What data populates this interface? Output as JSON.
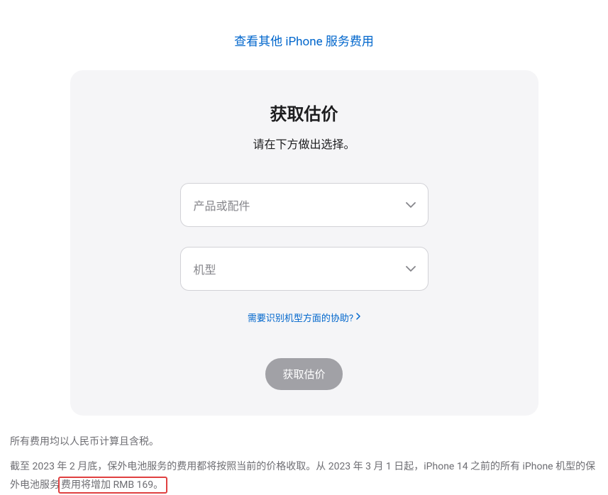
{
  "top_link": "查看其他 iPhone 服务费用",
  "card": {
    "title": "获取估价",
    "subtitle": "请在下方做出选择。",
    "select_product_placeholder": "产品或配件",
    "select_model_placeholder": "机型",
    "help_link": "需要识别机型方面的协助?",
    "submit_label": "获取估价"
  },
  "footer": {
    "line1": "所有费用均以人民币计算且含税。",
    "line2_part1": "截至 2023 年 2 月底，保外电池服务的费用都将按照当前的价格收取。从 2023 年 3 月 1 日起，iPhone 14 之前的所有 iPhone 机型的保外电池服",
    "line2_part2_prefix": "务",
    "line2_highlight": "费用将增加 RMB 169。"
  }
}
